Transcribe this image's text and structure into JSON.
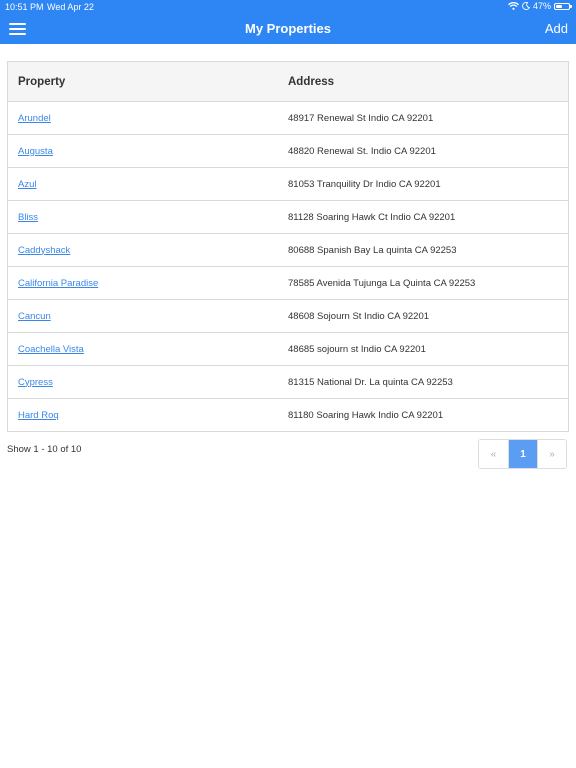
{
  "status_bar": {
    "time": "10:51 PM",
    "date": "Wed Apr 22",
    "battery": "47%",
    "battery_level": 0.47
  },
  "nav": {
    "title": "My Properties",
    "add_label": "Add",
    "menu_icon": "hamburger-menu-icon",
    "accent_color": "#2e86f5"
  },
  "table": {
    "headers": [
      "Property",
      "Address"
    ],
    "rows": [
      {
        "property": "Arundel",
        "address": "48917 Renewal St Indio CA 92201"
      },
      {
        "property": "Augusta",
        "address": "48820 Renewal St. Indio CA 92201"
      },
      {
        "property": "Azul",
        "address": "81053 Tranquility Dr Indio CA 92201"
      },
      {
        "property": "Bliss",
        "address": "81128 Soaring Hawk Ct Indio CA 92201"
      },
      {
        "property": "Caddyshack",
        "address": "80688 Spanish Bay La quinta CA 92253"
      },
      {
        "property": "California Paradise",
        "address": "78585 Avenida Tujunga La Quinta CA 92253"
      },
      {
        "property": "Cancun",
        "address": "48608 Sojourn St Indio CA 92201"
      },
      {
        "property": "Coachella Vista",
        "address": "48685 sojourn st Indio CA 92201"
      },
      {
        "property": "Cypress",
        "address": "81315 National Dr. La quinta CA 92253"
      },
      {
        "property": "Hard Roq",
        "address": "81180 Soaring Hawk Indio CA 92201"
      }
    ]
  },
  "footer": {
    "summary": "Show 1 - 10 of 10",
    "pagination": {
      "prev": "«",
      "current": "1",
      "next": "»"
    }
  }
}
